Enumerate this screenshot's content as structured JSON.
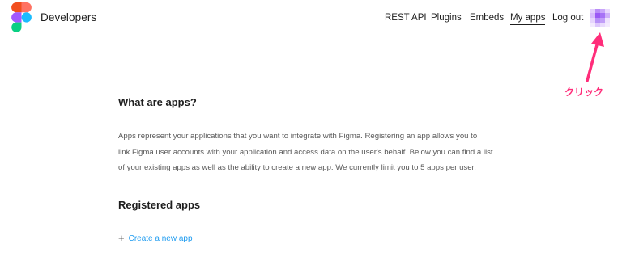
{
  "header": {
    "brand": "Developers",
    "nav": {
      "rest_api": "REST API",
      "plugins": "Plugins",
      "embeds": "Embeds",
      "my_apps": "My apps",
      "log_out": "Log out"
    }
  },
  "main": {
    "heading": "What are apps?",
    "description_lines": [
      "Apps represent your applications that you want to integrate with Figma. Registering an app allows you to",
      "link Figma user accounts with your application and access data on the user's behalf. Below you can find a list",
      "of your existing apps as well as the ability to create a new app. We currently limit you to 5 apps per user."
    ],
    "registered_heading": "Registered apps",
    "create_link": "Create a new app",
    "create_icon": "plus-icon"
  },
  "annotation": {
    "label": "クリック",
    "color": "#ff2d7a"
  },
  "colors": {
    "link": "#1d9bf0",
    "text": "#1e1e1e",
    "muted_text": "#5a5a5a",
    "logo_red": "#f24e1e",
    "logo_orange": "#ff7262",
    "logo_purple": "#a259ff",
    "logo_blue": "#1abcfe",
    "logo_green": "#0acf83",
    "avatar_purple": "#9b59f5"
  }
}
